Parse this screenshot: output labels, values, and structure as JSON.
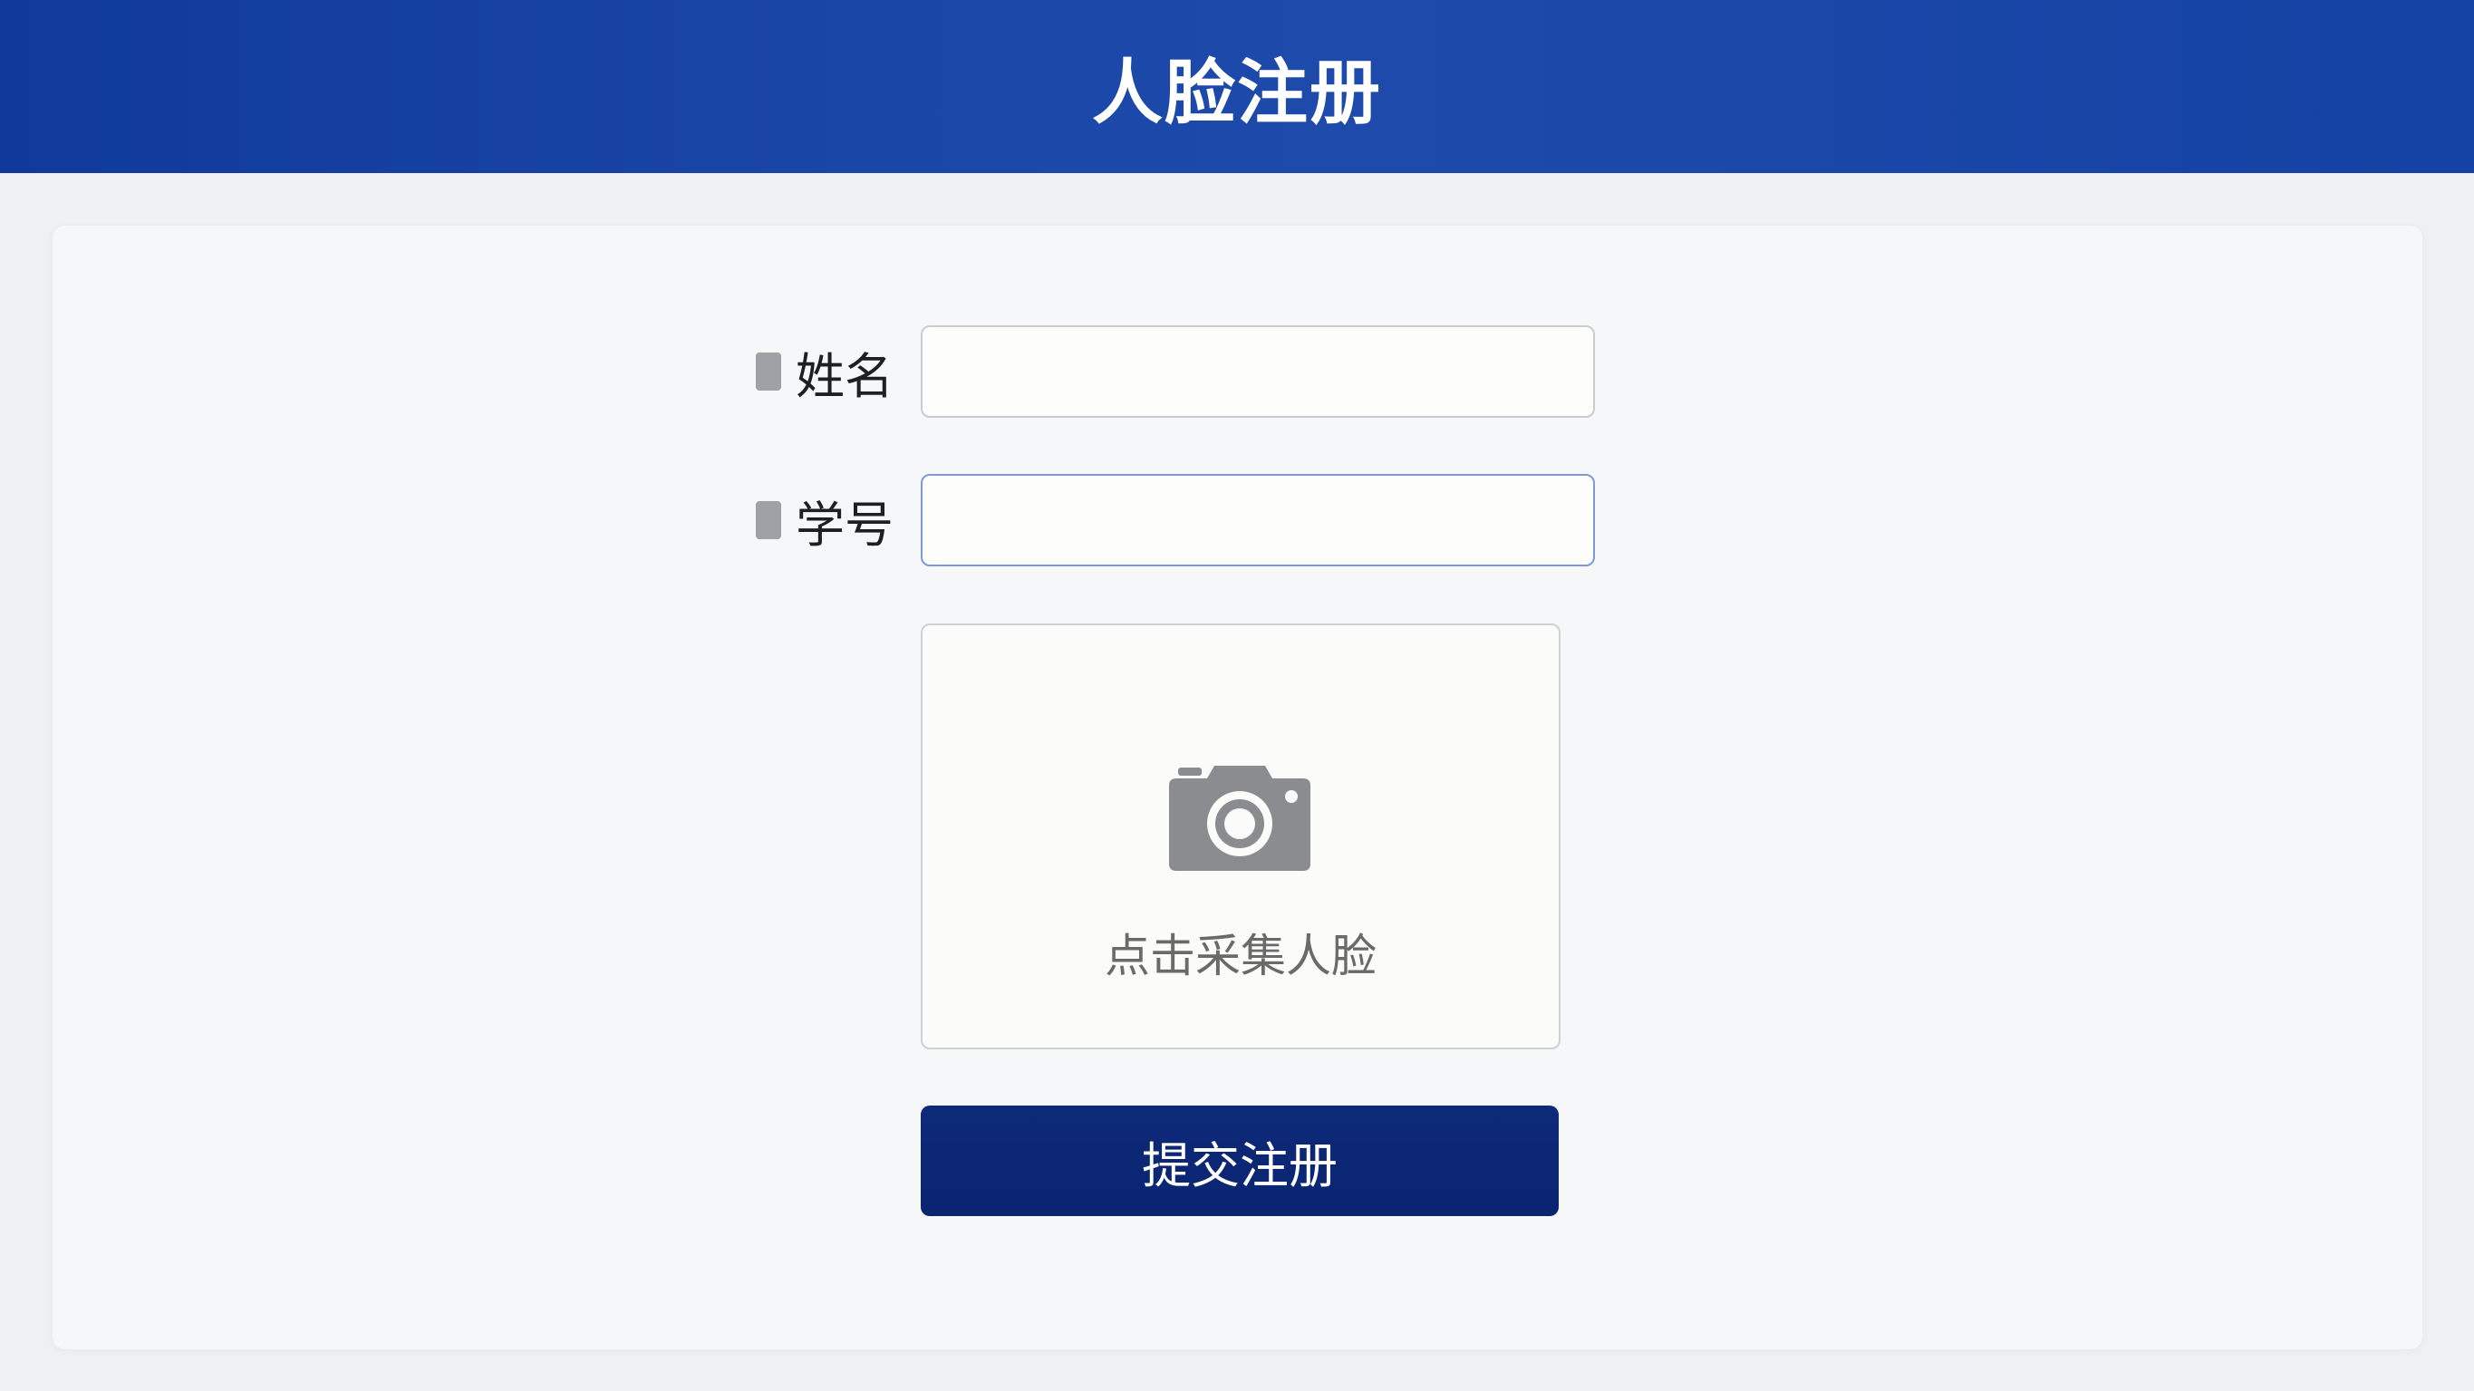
{
  "header": {
    "title": "人脸注册"
  },
  "form": {
    "name_label": "姓名",
    "name_value": "",
    "student_id_label": "学号",
    "student_id_value": "",
    "capture_icon": "camera-icon",
    "capture_label": "点击采集人脸",
    "submit_label": "提交注册"
  },
  "colors": {
    "header_bg": "#1a46a8",
    "submit_bg": "#0d2a78",
    "focus_border": "#7d98dc"
  }
}
